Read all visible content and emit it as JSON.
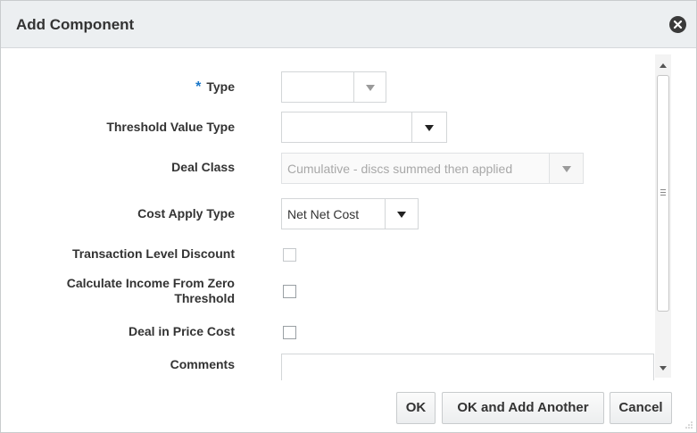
{
  "dialog": {
    "title": "Add Component",
    "close_icon": "close-circle-icon"
  },
  "form": {
    "required_marker": "*",
    "type": {
      "label": "Type",
      "value": ""
    },
    "threshold_value_type": {
      "label": "Threshold Value Type",
      "value": ""
    },
    "deal_class": {
      "label": "Deal Class",
      "value": "Cumulative - discs summed then applied",
      "disabled": true
    },
    "cost_apply_type": {
      "label": "Cost Apply Type",
      "value": "Net Net Cost"
    },
    "transaction_level_discount": {
      "label": "Transaction Level Discount",
      "checked": false
    },
    "calculate_income_from_zero_threshold": {
      "label_line1": "Calculate Income From Zero",
      "label_line2": "Threshold",
      "checked": false
    },
    "deal_in_price_cost": {
      "label": "Deal in Price Cost",
      "checked": false
    },
    "comments": {
      "label": "Comments",
      "value": ""
    }
  },
  "footer": {
    "ok_label": "OK",
    "ok_add_another_label": "OK and Add Another",
    "cancel_label": "Cancel"
  },
  "colors": {
    "titlebar_bg": "#eceff1",
    "required_marker": "#1a77c9",
    "disabled_text": "#a8a8a8"
  }
}
